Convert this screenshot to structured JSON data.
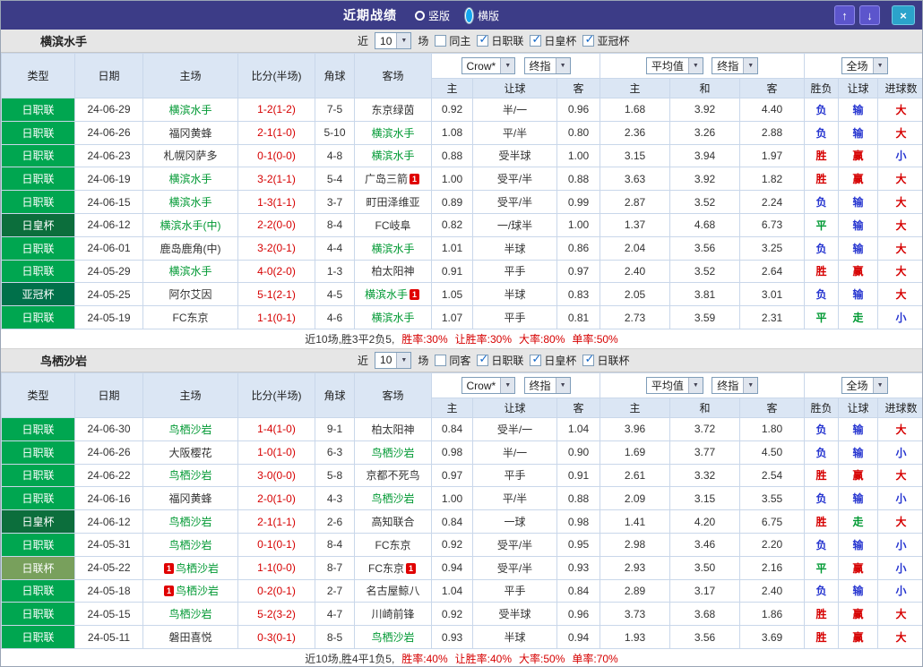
{
  "titlebar": {
    "title": "近期战绩",
    "radios": [
      {
        "label": "竖版",
        "selected": false
      },
      {
        "label": "横版",
        "selected": true
      }
    ],
    "buttons": {
      "up": "↑",
      "down": "↓",
      "close": "×"
    }
  },
  "ui": {
    "dropdown_arrow": "▼",
    "check_glyph": "✓"
  },
  "card_label": "1",
  "value_colors": {
    "胜": "#d60000",
    "赢": "#d60000",
    "大": "#d60000",
    "负": "#2635d0",
    "输": "#2635d0",
    "小": "#2635d0",
    "平": "#009933",
    "走": "#009933"
  },
  "league_colors": {
    "日职联": "#00a650",
    "日皇杯": "#0c6e3c",
    "亚冠杯": "#00704a",
    "日联杯": "#78a05c"
  },
  "columns": [
    "类型",
    "日期",
    "主场",
    "比分(半场)",
    "角球",
    "客场",
    "主",
    "让球",
    "客",
    "主",
    "和",
    "客",
    "胜负",
    "让球",
    "进球数"
  ],
  "sections": [
    {
      "team": "横滨水手",
      "near_label": "近",
      "games": "10",
      "games_suffix": "场",
      "same_label": "同主",
      "same_checked": false,
      "leagues": [
        {
          "label": "日职联",
          "checked": true
        },
        {
          "label": "日皇杯",
          "checked": true
        },
        {
          "label": "亚冠杯",
          "checked": true
        }
      ],
      "filters": {
        "bookmaker": "Crow*",
        "book_time": "终指",
        "avg": "平均值",
        "avg_time": "终指",
        "scope": "全场"
      },
      "rows": [
        {
          "league": "日职联",
          "date": "24-06-29",
          "home": "横滨水手",
          "home_green": true,
          "home_card": false,
          "score": "1-2(1-2)",
          "corners": "7-5",
          "away": "东京绿茵",
          "away_green": false,
          "away_card": false,
          "odds": [
            "0.92",
            "半/一",
            "0.96"
          ],
          "euro": [
            "1.68",
            "3.92",
            "4.40"
          ],
          "res": "负",
          "cover": "输",
          "goals": "大"
        },
        {
          "league": "日职联",
          "date": "24-06-26",
          "home": "福冈黄蜂",
          "home_green": false,
          "home_card": false,
          "score": "2-1(1-0)",
          "corners": "5-10",
          "away": "横滨水手",
          "away_green": true,
          "away_card": false,
          "odds": [
            "1.08",
            "平/半",
            "0.80"
          ],
          "euro": [
            "2.36",
            "3.26",
            "2.88"
          ],
          "res": "负",
          "cover": "输",
          "goals": "大"
        },
        {
          "league": "日职联",
          "date": "24-06-23",
          "home": "札幌冈萨多",
          "home_green": false,
          "home_card": false,
          "score": "0-1(0-0)",
          "corners": "4-8",
          "away": "横滨水手",
          "away_green": true,
          "away_card": false,
          "odds": [
            "0.88",
            "受半球",
            "1.00"
          ],
          "euro": [
            "3.15",
            "3.94",
            "1.97"
          ],
          "res": "胜",
          "cover": "赢",
          "goals": "小"
        },
        {
          "league": "日职联",
          "date": "24-06-19",
          "home": "横滨水手",
          "home_green": true,
          "home_card": false,
          "score": "3-2(1-1)",
          "corners": "5-4",
          "away": "广岛三箭",
          "away_green": false,
          "away_card": true,
          "odds": [
            "1.00",
            "受平/半",
            "0.88"
          ],
          "euro": [
            "3.63",
            "3.92",
            "1.82"
          ],
          "res": "胜",
          "cover": "赢",
          "goals": "大"
        },
        {
          "league": "日职联",
          "date": "24-06-15",
          "home": "横滨水手",
          "home_green": true,
          "home_card": false,
          "score": "1-3(1-1)",
          "corners": "3-7",
          "away": "町田泽维亚",
          "away_green": false,
          "away_card": false,
          "odds": [
            "0.89",
            "受平/半",
            "0.99"
          ],
          "euro": [
            "2.87",
            "3.52",
            "2.24"
          ],
          "res": "负",
          "cover": "输",
          "goals": "大"
        },
        {
          "league": "日皇杯",
          "date": "24-06-12",
          "home": "横滨水手(中)",
          "home_green": true,
          "home_card": false,
          "score": "2-2(0-0)",
          "corners": "8-4",
          "away": "FC岐阜",
          "away_green": false,
          "away_card": false,
          "odds": [
            "0.82",
            "一/球半",
            "1.00"
          ],
          "euro": [
            "1.37",
            "4.68",
            "6.73"
          ],
          "res": "平",
          "cover": "输",
          "goals": "大"
        },
        {
          "league": "日职联",
          "date": "24-06-01",
          "home": "鹿岛鹿角(中)",
          "home_green": false,
          "home_card": false,
          "score": "3-2(0-1)",
          "corners": "4-4",
          "away": "横滨水手",
          "away_green": true,
          "away_card": false,
          "odds": [
            "1.01",
            "半球",
            "0.86"
          ],
          "euro": [
            "2.04",
            "3.56",
            "3.25"
          ],
          "res": "负",
          "cover": "输",
          "goals": "大"
        },
        {
          "league": "日职联",
          "date": "24-05-29",
          "home": "横滨水手",
          "home_green": true,
          "home_card": false,
          "score": "4-0(2-0)",
          "corners": "1-3",
          "away": "柏太阳神",
          "away_green": false,
          "away_card": false,
          "odds": [
            "0.91",
            "平手",
            "0.97"
          ],
          "euro": [
            "2.40",
            "3.52",
            "2.64"
          ],
          "res": "胜",
          "cover": "赢",
          "goals": "大"
        },
        {
          "league": "亚冠杯",
          "date": "24-05-25",
          "home": "阿尔艾因",
          "home_green": false,
          "home_card": false,
          "score": "5-1(2-1)",
          "corners": "4-5",
          "away": "横滨水手",
          "away_green": true,
          "away_card": true,
          "odds": [
            "1.05",
            "半球",
            "0.83"
          ],
          "euro": [
            "2.05",
            "3.81",
            "3.01"
          ],
          "res": "负",
          "cover": "输",
          "goals": "大"
        },
        {
          "league": "日职联",
          "date": "24-05-19",
          "home": "FC东京",
          "home_green": false,
          "home_card": false,
          "score": "1-1(0-1)",
          "corners": "4-6",
          "away": "横滨水手",
          "away_green": true,
          "away_card": false,
          "odds": [
            "1.07",
            "平手",
            "0.81"
          ],
          "euro": [
            "2.73",
            "3.59",
            "2.31"
          ],
          "res": "平",
          "cover": "走",
          "goals": "小"
        }
      ],
      "summary_prefix": "近10场,胜3平2负5,",
      "summary_stats": [
        "胜率:30%",
        "让胜率:30%",
        "大率:80%",
        "单率:50%"
      ]
    },
    {
      "team": "鸟栖沙岩",
      "near_label": "近",
      "games": "10",
      "games_suffix": "场",
      "same_label": "同客",
      "same_checked": false,
      "leagues": [
        {
          "label": "日职联",
          "checked": true
        },
        {
          "label": "日皇杯",
          "checked": true
        },
        {
          "label": "日联杯",
          "checked": true
        }
      ],
      "filters": {
        "bookmaker": "Crow*",
        "book_time": "终指",
        "avg": "平均值",
        "avg_time": "终指",
        "scope": "全场"
      },
      "rows": [
        {
          "league": "日职联",
          "date": "24-06-30",
          "home": "鸟栖沙岩",
          "home_green": true,
          "home_card": false,
          "score": "1-4(1-0)",
          "corners": "9-1",
          "away": "柏太阳神",
          "away_green": false,
          "away_card": false,
          "odds": [
            "0.84",
            "受半/一",
            "1.04"
          ],
          "euro": [
            "3.96",
            "3.72",
            "1.80"
          ],
          "res": "负",
          "cover": "输",
          "goals": "大"
        },
        {
          "league": "日职联",
          "date": "24-06-26",
          "home": "大阪樱花",
          "home_green": false,
          "home_card": false,
          "score": "1-0(1-0)",
          "corners": "6-3",
          "away": "鸟栖沙岩",
          "away_green": true,
          "away_card": false,
          "odds": [
            "0.98",
            "半/一",
            "0.90"
          ],
          "euro": [
            "1.69",
            "3.77",
            "4.50"
          ],
          "res": "负",
          "cover": "输",
          "goals": "小"
        },
        {
          "league": "日职联",
          "date": "24-06-22",
          "home": "鸟栖沙岩",
          "home_green": true,
          "home_card": false,
          "score": "3-0(0-0)",
          "corners": "5-8",
          "away": "京都不死鸟",
          "away_green": false,
          "away_card": false,
          "odds": [
            "0.97",
            "平手",
            "0.91"
          ],
          "euro": [
            "2.61",
            "3.32",
            "2.54"
          ],
          "res": "胜",
          "cover": "赢",
          "goals": "大"
        },
        {
          "league": "日职联",
          "date": "24-06-16",
          "home": "福冈黄蜂",
          "home_green": false,
          "home_card": false,
          "score": "2-0(1-0)",
          "corners": "4-3",
          "away": "鸟栖沙岩",
          "away_green": true,
          "away_card": false,
          "odds": [
            "1.00",
            "平/半",
            "0.88"
          ],
          "euro": [
            "2.09",
            "3.15",
            "3.55"
          ],
          "res": "负",
          "cover": "输",
          "goals": "小"
        },
        {
          "league": "日皇杯",
          "date": "24-06-12",
          "home": "鸟栖沙岩",
          "home_green": true,
          "home_card": false,
          "score": "2-1(1-1)",
          "corners": "2-6",
          "away": "高知联合",
          "away_green": false,
          "away_card": false,
          "odds": [
            "0.84",
            "一球",
            "0.98"
          ],
          "euro": [
            "1.41",
            "4.20",
            "6.75"
          ],
          "res": "胜",
          "cover": "走",
          "goals": "大"
        },
        {
          "league": "日职联",
          "date": "24-05-31",
          "home": "鸟栖沙岩",
          "home_green": true,
          "home_card": false,
          "score": "0-1(0-1)",
          "corners": "8-4",
          "away": "FC东京",
          "away_green": false,
          "away_card": false,
          "odds": [
            "0.92",
            "受平/半",
            "0.95"
          ],
          "euro": [
            "2.98",
            "3.46",
            "2.20"
          ],
          "res": "负",
          "cover": "输",
          "goals": "小"
        },
        {
          "league": "日联杯",
          "date": "24-05-22",
          "home": "鸟栖沙岩",
          "home_green": true,
          "home_card": true,
          "score": "1-1(0-0)",
          "corners": "8-7",
          "away": "FC东京",
          "away_green": false,
          "away_card": true,
          "odds": [
            "0.94",
            "受平/半",
            "0.93"
          ],
          "euro": [
            "2.93",
            "3.50",
            "2.16"
          ],
          "res": "平",
          "cover": "赢",
          "goals": "小"
        },
        {
          "league": "日职联",
          "date": "24-05-18",
          "home": "鸟栖沙岩",
          "home_green": true,
          "home_card": true,
          "score": "0-2(0-1)",
          "corners": "2-7",
          "away": "名古屋鲸八",
          "away_green": false,
          "away_card": false,
          "odds": [
            "1.04",
            "平手",
            "0.84"
          ],
          "euro": [
            "2.89",
            "3.17",
            "2.40"
          ],
          "res": "负",
          "cover": "输",
          "goals": "小"
        },
        {
          "league": "日职联",
          "date": "24-05-15",
          "home": "鸟栖沙岩",
          "home_green": true,
          "home_card": false,
          "score": "5-2(3-2)",
          "corners": "4-7",
          "away": "川崎前锋",
          "away_green": false,
          "away_card": false,
          "odds": [
            "0.92",
            "受半球",
            "0.96"
          ],
          "euro": [
            "3.73",
            "3.68",
            "1.86"
          ],
          "res": "胜",
          "cover": "赢",
          "goals": "大"
        },
        {
          "league": "日职联",
          "date": "24-05-11",
          "home": "磐田喜悦",
          "home_green": false,
          "home_card": false,
          "score": "0-3(0-1)",
          "corners": "8-5",
          "away": "鸟栖沙岩",
          "away_green": true,
          "away_card": false,
          "odds": [
            "0.93",
            "半球",
            "0.94"
          ],
          "euro": [
            "1.93",
            "3.56",
            "3.69"
          ],
          "res": "胜",
          "cover": "赢",
          "goals": "大"
        }
      ],
      "summary_prefix": "近10场,胜4平1负5,",
      "summary_stats": [
        "胜率:40%",
        "让胜率:40%",
        "大率:50%",
        "单率:70%"
      ]
    }
  ]
}
